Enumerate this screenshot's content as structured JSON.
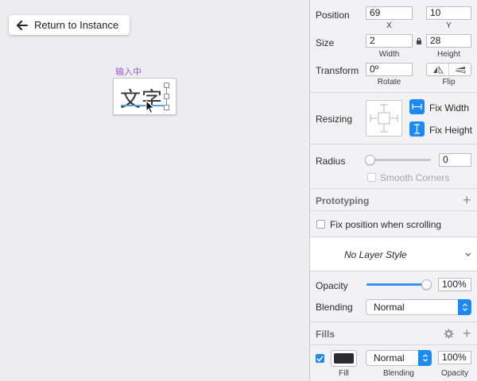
{
  "canvas": {
    "return_button": "Return to Instance",
    "ime_label": "输入中",
    "text_content": "文字"
  },
  "position": {
    "label": "Position",
    "x": "69",
    "y": "10",
    "x_label": "X",
    "y_label": "Y"
  },
  "size": {
    "label": "Size",
    "width": "2",
    "height": "28",
    "width_label": "Width",
    "height_label": "Height"
  },
  "transform": {
    "label": "Transform",
    "rotate": "0º",
    "rotate_label": "Rotate",
    "flip_label": "Flip"
  },
  "resizing": {
    "label": "Resizing",
    "fix_width": "Fix Width",
    "fix_height": "Fix Height"
  },
  "radius": {
    "label": "Radius",
    "value": "0",
    "smooth_corners": "Smooth Corners"
  },
  "prototyping": {
    "label": "Prototyping",
    "fix_position": "Fix position when scrolling"
  },
  "layer_style": {
    "value": "No Layer Style"
  },
  "appearance": {
    "opacity_label": "Opacity",
    "opacity_value": "100%",
    "opacity_fraction": 1.0,
    "blending_label": "Blending",
    "blending_value": "Normal"
  },
  "fills": {
    "label": "Fills",
    "blending_value": "Normal",
    "opacity_value": "100%",
    "fill_label": "Fill",
    "blending_label": "Blending",
    "opacity_label": "Opacity",
    "swatch_color": "#2b2b30",
    "enabled": true
  },
  "colors": {
    "accent": "#1d89f5",
    "ime_purple": "#9b59d0"
  }
}
